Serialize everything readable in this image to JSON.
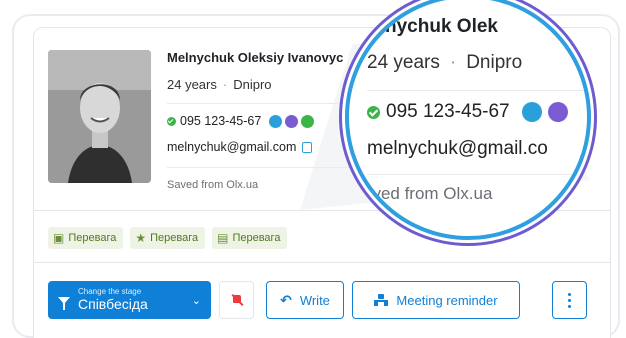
{
  "profile": {
    "name": "Melnychuk Oleksiy Ivanovyc",
    "age": "24 years",
    "city": "Dnipro",
    "phone": "095 123-45-67",
    "email": "melnychuk@gmail.com",
    "saved": "Saved from Olx.ua"
  },
  "zoom": {
    "name": "nychuk Olek",
    "age": "24 years",
    "city": "Dnipro",
    "phone": "095 123-45-67",
    "email": "melnychuk@gmail.co",
    "saved": "aved from Olx.ua"
  },
  "tags": [
    {
      "label": "Перевага",
      "icon": "badge-icon"
    },
    {
      "label": "Перевага",
      "icon": "star-icon"
    },
    {
      "label": "Перевага",
      "icon": "stack-icon"
    }
  ],
  "actions": {
    "stage_caption": "Change the stage",
    "stage_value": "Співбесіда",
    "write_label": "Write",
    "meeting_label": "Meeting reminder"
  },
  "colors": {
    "accent": "#0f80d6",
    "tag_bg": "#eef3e6",
    "tag_text": "#4f7a1f",
    "telegram": "#2b9fd9",
    "viber": "#7a5bd2",
    "whatsapp": "#3cb44a",
    "mute_red": "#ee3b3b"
  }
}
